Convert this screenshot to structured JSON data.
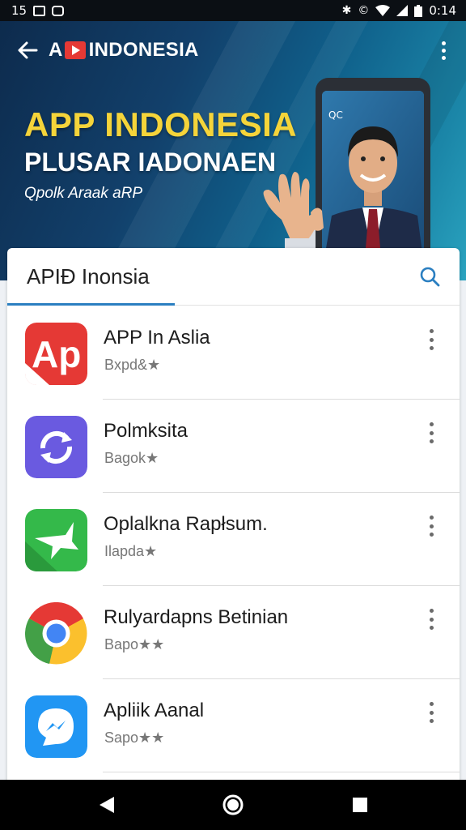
{
  "status_bar": {
    "time_left": "15",
    "clock": "0:14",
    "icons": [
      "image-icon",
      "notification-icon",
      "bluetooth-icon",
      "sync-icon",
      "wifi-icon",
      "signal-icon",
      "battery-icon"
    ]
  },
  "header": {
    "brand_prefix": "A",
    "brand_name": "INDONESIA"
  },
  "hero": {
    "title": "APP INDONESIA",
    "subtitle": "PLUSAR IADONAEN",
    "tagline": "Qpolk Araak aRP",
    "phone_logo": "QC"
  },
  "search": {
    "query": "APIĐ Inonsia"
  },
  "apps": [
    {
      "title": "APP In Aslia",
      "subtitle": "Bxpd&★",
      "icon": "ap-red-icon",
      "color": "#e53935"
    },
    {
      "title": "Polmksita",
      "subtitle": "Bagok★",
      "icon": "sync-purple-icon",
      "color": "#6a5ae0"
    },
    {
      "title": "Oplalkna Rapłsum.",
      "subtitle": "Ilapda★",
      "icon": "star-green-icon",
      "color": "#34b94a"
    },
    {
      "title": "Rulyardapns Betinian",
      "subtitle": "Bapo★★",
      "icon": "chrome-icon",
      "color": "#4285f4"
    },
    {
      "title": "Apliik Aanal",
      "subtitle": "Sapo★★",
      "icon": "messenger-blue-icon",
      "color": "#2196f3"
    }
  ],
  "colors": {
    "accent": "#2b7fc1",
    "title_yellow": "#f5d43a",
    "banner_dark": "#0d2b4d"
  }
}
